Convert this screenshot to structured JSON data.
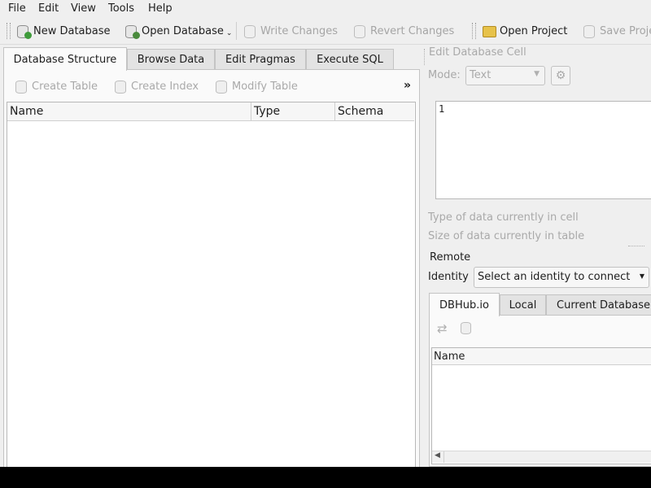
{
  "menubar": {
    "items": [
      {
        "label": "File"
      },
      {
        "label": "Edit"
      },
      {
        "label": "View"
      },
      {
        "label": "Tools"
      },
      {
        "label": "Help"
      }
    ]
  },
  "toolbar": {
    "new_database": "New Database",
    "open_database": "Open Database",
    "write_changes": "Write Changes",
    "revert_changes": "Revert Changes",
    "open_project": "Open Project",
    "save_project": "Save Project"
  },
  "main_tabs": [
    {
      "label": "Database Structure",
      "active": true
    },
    {
      "label": "Browse Data",
      "active": false
    },
    {
      "label": "Edit Pragmas",
      "active": false
    },
    {
      "label": "Execute SQL",
      "active": false
    }
  ],
  "structure_toolbar": {
    "create_table": "Create Table",
    "create_index": "Create Index",
    "modify_table": "Modify Table",
    "overflow": "»"
  },
  "structure_table": {
    "columns": [
      "Name",
      "Type",
      "Schema"
    ]
  },
  "edit_cell": {
    "title": "Edit Database Cell",
    "mode_label": "Mode:",
    "mode_value": "Text",
    "cell_value": "1",
    "type_info": "Type of data currently in cell",
    "size_info": "Size of data currently in table"
  },
  "remote": {
    "title": "Remote",
    "identity_label": "Identity",
    "identity_value": "Select an identity to connect",
    "tabs": [
      {
        "label": "DBHub.io",
        "active": true
      },
      {
        "label": "Local",
        "active": false
      },
      {
        "label": "Current Database",
        "active": false
      }
    ],
    "table_columns": [
      "Name"
    ]
  },
  "colors": {
    "window_bg": "#efefef",
    "disabled_text": "#a9a9a9",
    "accent_green": "#3f9b3b"
  }
}
